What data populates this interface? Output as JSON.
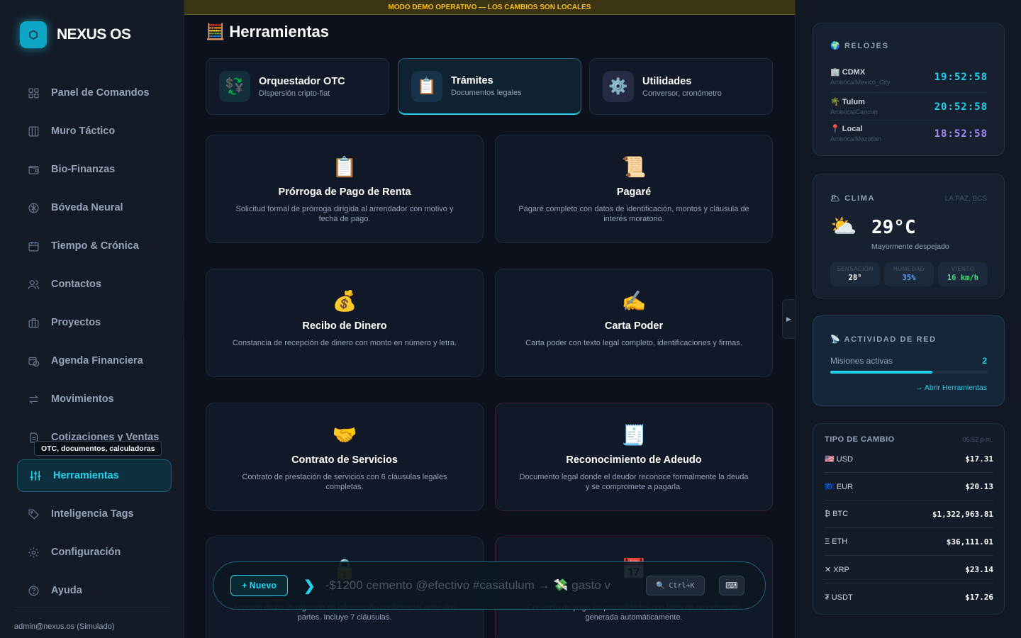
{
  "brand": {
    "name": "NEXUS OS",
    "logo_glyph": "⬡"
  },
  "sidebar": {
    "items": [
      {
        "label": "Panel de Comandos",
        "icon": "grid-icon"
      },
      {
        "label": "Muro Táctico",
        "icon": "columns-icon"
      },
      {
        "label": "Bio-Finanzas",
        "icon": "wallet-icon"
      },
      {
        "label": "Bóveda Neural",
        "icon": "brain-icon"
      },
      {
        "label": "Tiempo & Crónica",
        "icon": "calendar-icon"
      },
      {
        "label": "Contactos",
        "icon": "users-icon"
      },
      {
        "label": "Proyectos",
        "icon": "briefcase-icon"
      },
      {
        "label": "Agenda Financiera",
        "icon": "calendar-clock-icon"
      },
      {
        "label": "Movimientos",
        "icon": "arrows-icon"
      },
      {
        "label": "Cotizaciones y Ventas",
        "icon": "document-icon"
      },
      {
        "label": "Herramientas",
        "icon": "sliders-icon"
      },
      {
        "label": "Inteligencia Tags",
        "icon": "tag-icon"
      },
      {
        "label": "Configuración",
        "icon": "gear-icon"
      },
      {
        "label": "Ayuda",
        "icon": "help-icon"
      }
    ],
    "active_index": 10,
    "tooltip": "OTC, documentos, calculadoras",
    "user": "admin@nexus.os (Simulado)"
  },
  "main": {
    "banner": "MODO DEMO OPERATIVO — LOS CAMBIOS SON LOCALES",
    "title": "Herramientas",
    "title_icon": "🧮",
    "tabs": [
      {
        "title": "Orquestador OTC",
        "subtitle": "Dispersión cripto-fiat",
        "icon": "💱"
      },
      {
        "title": "Trámites",
        "subtitle": "Documentos legales",
        "icon": "📋"
      },
      {
        "title": "Utilidades",
        "subtitle": "Conversor, cronómetro",
        "icon": "⚙️"
      }
    ],
    "active_tab": 1,
    "cards": [
      {
        "icon": "📋",
        "title": "Prórroga de Pago de Renta",
        "desc": "Solicitud formal de prórroga dirigida al arrendador con motivo y fecha de pago."
      },
      {
        "icon": "📜",
        "title": "Pagaré",
        "desc": "Pagaré completo con datos de identificación, montos y cláusula de interés moratorio."
      },
      {
        "icon": "💰",
        "title": "Recibo de Dinero",
        "desc": "Constancia de recepción de dinero con monto en número y letra."
      },
      {
        "icon": "✍️",
        "title": "Carta Poder",
        "desc": "Carta poder con texto legal completo, identificaciones y firmas."
      },
      {
        "icon": "🤝",
        "title": "Contrato de Servicios",
        "desc": "Contrato de prestación de servicios con 6 cláusulas legales completas."
      },
      {
        "icon": "🧾",
        "title": "Reconocimiento de Adeudo",
        "desc": "Documento legal donde el deudor reconoce formalmente la deuda y se compromete a pagarla."
      },
      {
        "icon": "🔒",
        "title": "",
        "desc": "Acuerdo de no divulgación de información confidencial entre dos partes. Incluye 7 cláusulas."
      },
      {
        "icon": "📅",
        "title": "",
        "desc": "Convenio de pago en parcialidades con tabla de amortización generada automáticamente."
      }
    ]
  },
  "command_bar": {
    "new_label": "+ Nuevo",
    "chevron": "❯",
    "placeholder": "-$1200 cemento @efectivo #casatulum → 💸 gasto v",
    "search_label": "🔍 Ctrl+K",
    "keyboard_glyph": "⌨"
  },
  "widgets": {
    "clocks": {
      "title": "RELOJES",
      "title_icon": "🌍",
      "items": [
        {
          "name": "CDMX",
          "icon": "🏢",
          "tz": "America/Mexico_City",
          "time": "19:52:58"
        },
        {
          "name": "Tulum",
          "icon": "🌴",
          "tz": "America/Cancun",
          "time": "20:52:58"
        },
        {
          "name": "Local",
          "icon": "📍",
          "tz": "America/Mazatlan",
          "time": "18:52:58"
        }
      ]
    },
    "weather": {
      "title": "CLIMA",
      "title_icon": "🌥",
      "location": "LA PAZ, BCS",
      "icon": "⛅",
      "temp": "29°C",
      "desc": "Mayormente despejado",
      "stats": [
        {
          "label": "SENSACIÓN",
          "value": "28°",
          "color": "#ffffff"
        },
        {
          "label": "HUMEDAD",
          "value": "35%",
          "color": "#60a5fa"
        },
        {
          "label": "VIENTO",
          "value": "16 km/h",
          "color": "#4ade80"
        }
      ]
    },
    "network": {
      "title": "ACTIVIDAD DE RED",
      "title_icon": "📡",
      "label": "Misiones activas",
      "count": "2",
      "progress": 0.65,
      "link": "→ Abrir Herramientas"
    },
    "fx": {
      "title": "TIPO DE CAMBIO",
      "time": "06:52 p.m.",
      "rows": [
        {
          "code": "🇺🇸 USD",
          "value": "$17.31"
        },
        {
          "code": "🇪🇺 EUR",
          "value": "$20.13"
        },
        {
          "code": "₿ BTC",
          "value": "$1,322,963.81"
        },
        {
          "code": "Ξ ETH",
          "value": "$36,111.01"
        },
        {
          "code": "✕ XRP",
          "value": "$23.14"
        },
        {
          "code": "₮ USDT",
          "value": "$17.26"
        }
      ]
    }
  },
  "colors": {
    "accent": "#22d3ee",
    "banner": "#fbbf24",
    "local_time": "#a78bfa"
  }
}
